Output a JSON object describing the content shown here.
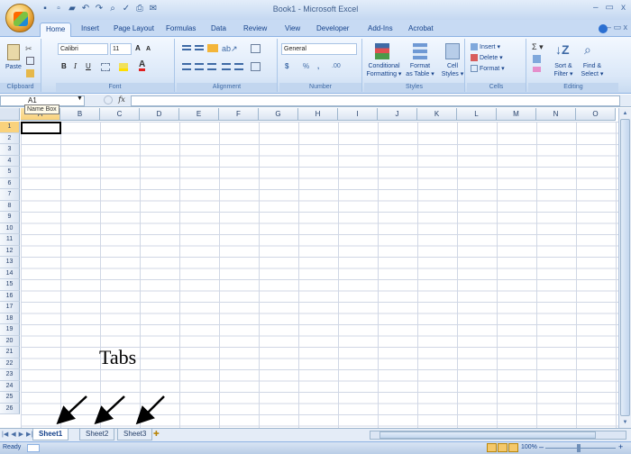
{
  "window": {
    "title": "Book1 - Microsoft Excel",
    "controls": [
      "–",
      "▭",
      "x"
    ]
  },
  "quick_access": {
    "icons": [
      "save-icon",
      "new-icon",
      "open-icon",
      "undo-icon",
      "redo-icon",
      "print-preview-icon",
      "spelling-icon",
      "print-icon",
      "send-icon"
    ]
  },
  "ribbon_tabs": [
    "Home",
    "Insert",
    "Page Layout",
    "Formulas",
    "Data",
    "Review",
    "View",
    "Developer",
    "Add-Ins",
    "Acrobat"
  ],
  "ribbon": {
    "clipboard": {
      "label": "Clipboard",
      "paste": "Paste"
    },
    "font": {
      "label": "Font",
      "name": "Calibri",
      "size": "11",
      "grow": "A",
      "shrink": "A",
      "bold": "B",
      "italic": "I",
      "underline": "U"
    },
    "alignment": {
      "label": "Alignment"
    },
    "number": {
      "label": "Number",
      "format": "General",
      "currency": "$",
      "percent": "%",
      "comma": ",",
      "inc_dec": ".00"
    },
    "styles": {
      "label": "Styles",
      "conditional": "Conditional Formatting",
      "cond_l1": "Conditional",
      "cond_l2": "Formatting ▾",
      "format_table_l1": "Format",
      "format_table_l2": "as Table ▾",
      "cell_styles_l1": "Cell",
      "cell_styles_l2": "Styles ▾"
    },
    "cells": {
      "label": "Cells",
      "insert": "Insert ▾",
      "delete": "Delete ▾",
      "format": "Format ▾"
    },
    "editing": {
      "label": "Editing",
      "sigma": "Σ ▾",
      "sort_l1": "Sort &",
      "sort_l2": "Filter ▾",
      "find_l1": "Find &",
      "find_l2": "Select ▾"
    }
  },
  "formula_bar": {
    "name_box_value": "A1",
    "name_box_tooltip": "Name Box",
    "fx": "fx",
    "formula_value": ""
  },
  "grid": {
    "columns": [
      "A",
      "B",
      "C",
      "D",
      "E",
      "F",
      "G",
      "H",
      "I",
      "J",
      "K",
      "L",
      "M",
      "N",
      "O"
    ],
    "rows": [
      "1",
      "2",
      "3",
      "4",
      "5",
      "6",
      "7",
      "8",
      "9",
      "10",
      "11",
      "12",
      "13",
      "14",
      "15",
      "16",
      "17",
      "18",
      "19",
      "20",
      "21",
      "22",
      "23",
      "24",
      "25",
      "26"
    ],
    "active_cell": "A1"
  },
  "sheet_tabs": [
    "Sheet1",
    "Sheet2",
    "Sheet3"
  ],
  "active_sheet": "Sheet1",
  "status": {
    "text": "Ready",
    "zoom": "100%",
    "zoom_minus": "–",
    "zoom_plus": "+"
  },
  "annotation": {
    "text": "Tabs"
  }
}
